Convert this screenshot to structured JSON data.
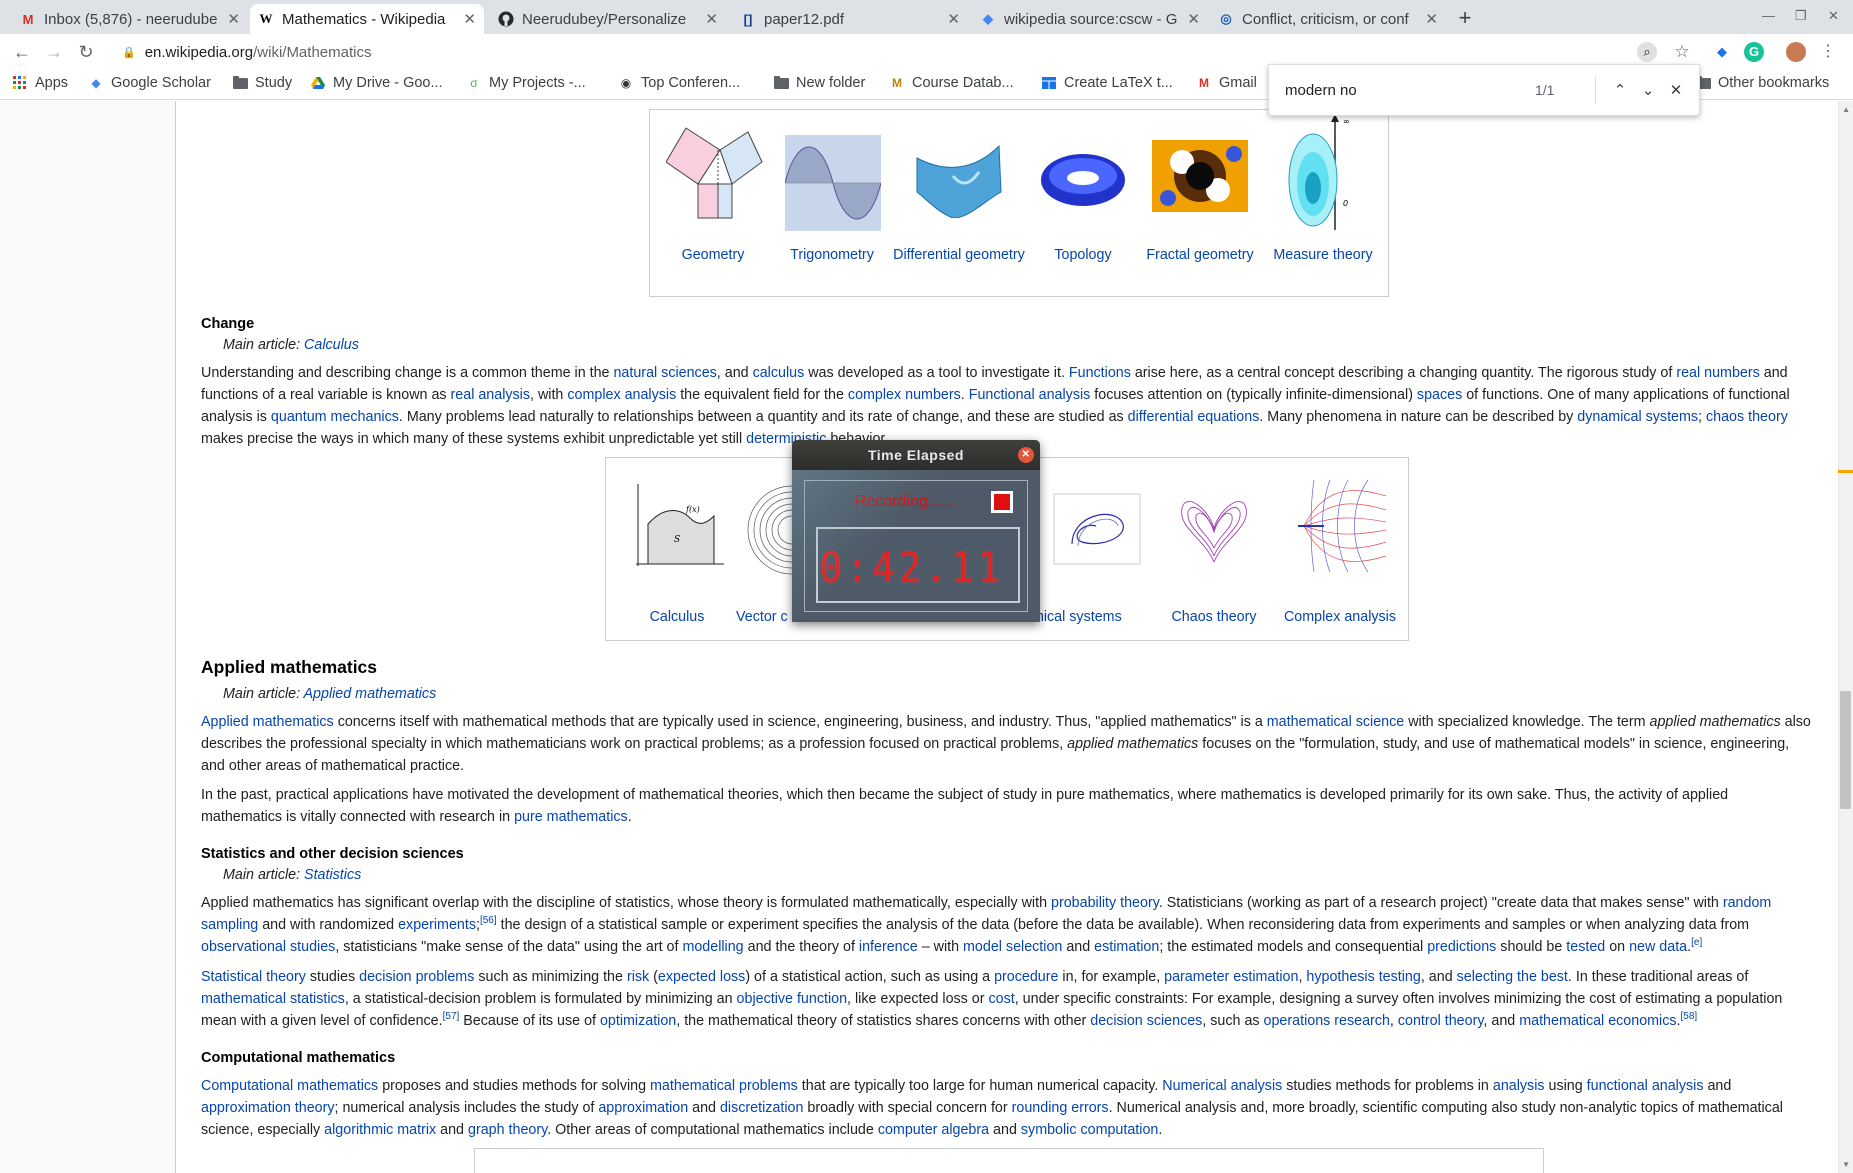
{
  "browser": {
    "tabs": [
      {
        "title": "Inbox (5,876) - neerudube",
        "icon": "gmail-icon",
        "active": false
      },
      {
        "title": "Mathematics - Wikipedia",
        "icon": "wikipedia-icon",
        "active": true
      },
      {
        "title": "Neerudubey/Personalize",
        "icon": "github-icon",
        "active": false
      },
      {
        "title": "paper12.pdf",
        "icon": "overleaf-icon",
        "active": false
      },
      {
        "title": "wikipedia source:cscw - G",
        "icon": "scholar-icon",
        "active": false
      },
      {
        "title": "Conflict, criticism, or conf",
        "icon": "acm-icon",
        "active": false
      }
    ],
    "new_tab": "+",
    "url_host": "en.wikipedia.org",
    "url_path": "/wiki/Mathematics",
    "bookmarks": [
      {
        "label": "Apps",
        "icon": "apps-grid-icon"
      },
      {
        "label": "Google Scholar",
        "icon": "scholar-icon"
      },
      {
        "label": "Study",
        "icon": "folder-icon"
      },
      {
        "label": "My Drive - Goo...",
        "icon": "drive-icon"
      },
      {
        "label": "My Projects -...",
        "icon": "projects-icon"
      },
      {
        "label": "Top Conferen...",
        "icon": "globe-icon"
      },
      {
        "label": "New folder",
        "icon": "folder-icon"
      },
      {
        "label": "Course Datab...",
        "icon": "course-icon"
      },
      {
        "label": "Create LaTeX t...",
        "icon": "table-icon"
      },
      {
        "label": "Gmail",
        "icon": "gmail-icon"
      },
      {
        "label": "Other bookmarks",
        "icon": "folder-icon"
      }
    ],
    "find": {
      "query": "modern no",
      "count": "1/1"
    }
  },
  "timer": {
    "title": "Time Elapsed",
    "status": "Recording......",
    "time": "0:42.11"
  },
  "gallery_top": [
    "Geometry",
    "Trigonometry",
    "Differential geometry",
    "Topology",
    "Fractal geometry",
    "Measure theory"
  ],
  "gallery_change": [
    "Calculus",
    "Vector c",
    "amical systems",
    "Chaos theory",
    "Complex analysis"
  ],
  "article": {
    "change_heading": "Change",
    "change_main_prefix": "Main article: ",
    "change_main_link": "Calculus",
    "applied_heading": "Applied mathematics",
    "applied_main_prefix": "Main article: ",
    "applied_main_link": "Applied mathematics",
    "stats_heading": "Statistics and other decision sciences",
    "stats_main_prefix": "Main article: ",
    "stats_main_link": "Statistics",
    "comp_heading": "Computational mathematics",
    "change_para": [
      {
        "t": "Understanding and describing change is a common theme in the "
      },
      {
        "l": "natural sciences"
      },
      {
        "t": ", and "
      },
      {
        "l": "calculus"
      },
      {
        "t": " was developed as a tool to investigate it. "
      },
      {
        "l": "Functions"
      },
      {
        "t": " arise here, as a central concept describing a changing quantity. The rigorous study of "
      },
      {
        "l": "real numbers"
      },
      {
        "t": " and functions of a real variable is known as "
      },
      {
        "l": "real analysis"
      },
      {
        "t": ", with "
      },
      {
        "l": "complex analysis"
      },
      {
        "t": " the equivalent field for the "
      },
      {
        "l": "complex numbers"
      },
      {
        "t": ". "
      },
      {
        "l": "Functional analysis"
      },
      {
        "t": " focuses attention on (typically infinite-dimensional) "
      },
      {
        "l": "spaces"
      },
      {
        "t": " of functions. One of many applications of functional analysis is "
      },
      {
        "l": "quantum mechanics"
      },
      {
        "t": ". Many problems lead naturally to relationships between a quantity and its rate of change, and these are studied as "
      },
      {
        "l": "differential equations"
      },
      {
        "t": ". Many phenomena in nature can be described by "
      },
      {
        "l": "dynamical systems"
      },
      {
        "t": "; "
      },
      {
        "l": "chaos theory"
      },
      {
        "t": " makes precise the ways in which many of these systems exhibit unpredictable yet still "
      },
      {
        "l": "deterministic"
      },
      {
        "t": " behavior."
      }
    ],
    "applied_para1": [
      {
        "l": "Applied mathematics"
      },
      {
        "t": " concerns itself with mathematical methods that are typically used in science, engineering, business, and industry. Thus, \"applied mathematics\" is a "
      },
      {
        "l": "mathematical science"
      },
      {
        "t": " with specialized knowledge. The term "
      },
      {
        "i": "applied mathematics"
      },
      {
        "t": " also describes the professional specialty in which mathematicians work on practical problems; as a profession focused on practical problems, "
      },
      {
        "i": "applied mathematics"
      },
      {
        "t": " focuses on the \"formulation, study, and use of mathematical models\" in science, engineering, and other areas of mathematical practice."
      }
    ],
    "applied_para2": [
      {
        "t": "In the past, practical applications have motivated the development of mathematical theories, which then became the subject of study in pure mathematics, where mathematics is developed primarily for its own sake. Thus, the activity of applied mathematics is vitally connected with research in "
      },
      {
        "l": "pure mathematics"
      },
      {
        "t": "."
      }
    ],
    "stats_para1": [
      {
        "t": "Applied mathematics has significant overlap with the discipline of statistics, whose theory is formulated mathematically, especially with "
      },
      {
        "l": "probability theory"
      },
      {
        "t": ". Statisticians (working as part of a research project) \"create data that makes sense\" with "
      },
      {
        "l": "random sampling"
      },
      {
        "t": " and with randomized "
      },
      {
        "l": "experiments"
      },
      {
        "t": ";"
      },
      {
        "s": "[56]"
      },
      {
        "t": " the design of a statistical sample or experiment specifies the analysis of the data (before the data be available). When reconsidering data from experiments and samples or when analyzing data from "
      },
      {
        "l": "observational studies"
      },
      {
        "t": ", statisticians \"make sense of the data\" using the art of "
      },
      {
        "l": "modelling"
      },
      {
        "t": " and the theory of "
      },
      {
        "l": "inference"
      },
      {
        "t": " – with "
      },
      {
        "l": "model selection"
      },
      {
        "t": " and "
      },
      {
        "l": "estimation"
      },
      {
        "t": "; the estimated models and consequential "
      },
      {
        "l": "predictions"
      },
      {
        "t": " should be "
      },
      {
        "l": "tested"
      },
      {
        "t": " on "
      },
      {
        "l": "new data"
      },
      {
        "t": "."
      },
      {
        "s": "[e]"
      }
    ],
    "stats_para2": [
      {
        "l": "Statistical theory"
      },
      {
        "t": " studies "
      },
      {
        "l": "decision problems"
      },
      {
        "t": " such as minimizing the "
      },
      {
        "l": "risk"
      },
      {
        "t": " ("
      },
      {
        "l": "expected loss"
      },
      {
        "t": ") of a statistical action, such as using a "
      },
      {
        "l": "procedure"
      },
      {
        "t": " in, for example, "
      },
      {
        "l": "parameter estimation"
      },
      {
        "t": ", "
      },
      {
        "l": "hypothesis testing"
      },
      {
        "t": ", and "
      },
      {
        "l": "selecting the best"
      },
      {
        "t": ". In these traditional areas of "
      },
      {
        "l": "mathematical statistics"
      },
      {
        "t": ", a statistical-decision problem is formulated by minimizing an "
      },
      {
        "l": "objective function"
      },
      {
        "t": ", like expected loss or "
      },
      {
        "l": "cost"
      },
      {
        "t": ", under specific constraints: For example, designing a survey often involves minimizing the cost of estimating a population mean with a given level of confidence."
      },
      {
        "s": "[57]"
      },
      {
        "t": " Because of its use of "
      },
      {
        "l": "optimization"
      },
      {
        "t": ", the mathematical theory of statistics shares concerns with other "
      },
      {
        "l": "decision sciences"
      },
      {
        "t": ", such as "
      },
      {
        "l": "operations research"
      },
      {
        "t": ", "
      },
      {
        "l": "control theory"
      },
      {
        "t": ", and "
      },
      {
        "l": "mathematical economics"
      },
      {
        "t": "."
      },
      {
        "s": "[58]"
      }
    ],
    "comp_para": [
      {
        "l": "Computational mathematics"
      },
      {
        "t": " proposes and studies methods for solving "
      },
      {
        "l": "mathematical problems"
      },
      {
        "t": " that are typically too large for human numerical capacity. "
      },
      {
        "l": "Numerical analysis"
      },
      {
        "t": " studies methods for problems in "
      },
      {
        "l": "analysis"
      },
      {
        "t": " using "
      },
      {
        "l": "functional analysis"
      },
      {
        "t": " and "
      },
      {
        "l": "approximation theory"
      },
      {
        "t": "; numerical analysis includes the study of "
      },
      {
        "l": "approximation"
      },
      {
        "t": " and "
      },
      {
        "l": "discretization"
      },
      {
        "t": " broadly with special concern for "
      },
      {
        "l": "rounding errors"
      },
      {
        "t": ". Numerical analysis and, more broadly, scientific computing also study non-analytic topics of mathematical science, especially "
      },
      {
        "l": "algorithmic matrix"
      },
      {
        "t": " and "
      },
      {
        "l": "graph theory"
      },
      {
        "t": ". Other areas of computational mathematics include "
      },
      {
        "l": "computer algebra"
      },
      {
        "t": " and "
      },
      {
        "l": "symbolic computation"
      },
      {
        "t": "."
      }
    ]
  },
  "colors": {
    "link": "#0645ad",
    "tab_strip": "#dee1e6",
    "timer_digits": "#e02424"
  }
}
